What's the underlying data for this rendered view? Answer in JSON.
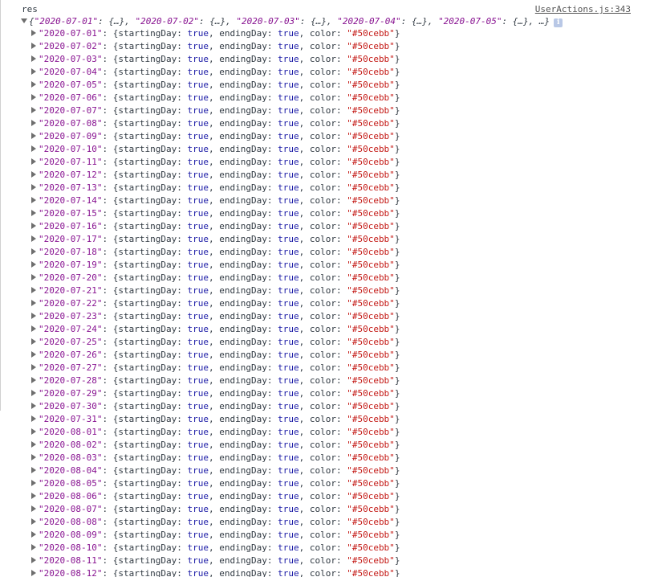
{
  "console": {
    "log_label": "res",
    "source_link": "UserActions.js:343",
    "summary": {
      "prefix": "{",
      "preview_keys": [
        "\"2020-07-01\"",
        "\"2020-07-02\"",
        "\"2020-07-03\"",
        "\"2020-07-04\"",
        "\"2020-07-05\""
      ],
      "preview_value": "{…}",
      "suffix": "…}",
      "info_icon": "i"
    },
    "field_labels": {
      "starting": "startingDay",
      "ending": "endingDay",
      "color": "color"
    },
    "colors": {
      "key": "#881391",
      "boolean": "#1a1aa6",
      "string": "#c41a16",
      "info_icon": "#b9c8e6"
    },
    "entries": [
      {
        "key": "\"2020-07-01\"",
        "startingDay": "true",
        "endingDay": "true",
        "color": "\"#50cebb\""
      },
      {
        "key": "\"2020-07-02\"",
        "startingDay": "true",
        "endingDay": "true",
        "color": "\"#50cebb\""
      },
      {
        "key": "\"2020-07-03\"",
        "startingDay": "true",
        "endingDay": "true",
        "color": "\"#50cebb\""
      },
      {
        "key": "\"2020-07-04\"",
        "startingDay": "true",
        "endingDay": "true",
        "color": "\"#50cebb\""
      },
      {
        "key": "\"2020-07-05\"",
        "startingDay": "true",
        "endingDay": "true",
        "color": "\"#50cebb\""
      },
      {
        "key": "\"2020-07-06\"",
        "startingDay": "true",
        "endingDay": "true",
        "color": "\"#50cebb\""
      },
      {
        "key": "\"2020-07-07\"",
        "startingDay": "true",
        "endingDay": "true",
        "color": "\"#50cebb\""
      },
      {
        "key": "\"2020-07-08\"",
        "startingDay": "true",
        "endingDay": "true",
        "color": "\"#50cebb\""
      },
      {
        "key": "\"2020-07-09\"",
        "startingDay": "true",
        "endingDay": "true",
        "color": "\"#50cebb\""
      },
      {
        "key": "\"2020-07-10\"",
        "startingDay": "true",
        "endingDay": "true",
        "color": "\"#50cebb\""
      },
      {
        "key": "\"2020-07-11\"",
        "startingDay": "true",
        "endingDay": "true",
        "color": "\"#50cebb\""
      },
      {
        "key": "\"2020-07-12\"",
        "startingDay": "true",
        "endingDay": "true",
        "color": "\"#50cebb\""
      },
      {
        "key": "\"2020-07-13\"",
        "startingDay": "true",
        "endingDay": "true",
        "color": "\"#50cebb\""
      },
      {
        "key": "\"2020-07-14\"",
        "startingDay": "true",
        "endingDay": "true",
        "color": "\"#50cebb\""
      },
      {
        "key": "\"2020-07-15\"",
        "startingDay": "true",
        "endingDay": "true",
        "color": "\"#50cebb\""
      },
      {
        "key": "\"2020-07-16\"",
        "startingDay": "true",
        "endingDay": "true",
        "color": "\"#50cebb\""
      },
      {
        "key": "\"2020-07-17\"",
        "startingDay": "true",
        "endingDay": "true",
        "color": "\"#50cebb\""
      },
      {
        "key": "\"2020-07-18\"",
        "startingDay": "true",
        "endingDay": "true",
        "color": "\"#50cebb\""
      },
      {
        "key": "\"2020-07-19\"",
        "startingDay": "true",
        "endingDay": "true",
        "color": "\"#50cebb\""
      },
      {
        "key": "\"2020-07-20\"",
        "startingDay": "true",
        "endingDay": "true",
        "color": "\"#50cebb\""
      },
      {
        "key": "\"2020-07-21\"",
        "startingDay": "true",
        "endingDay": "true",
        "color": "\"#50cebb\""
      },
      {
        "key": "\"2020-07-22\"",
        "startingDay": "true",
        "endingDay": "true",
        "color": "\"#50cebb\""
      },
      {
        "key": "\"2020-07-23\"",
        "startingDay": "true",
        "endingDay": "true",
        "color": "\"#50cebb\""
      },
      {
        "key": "\"2020-07-24\"",
        "startingDay": "true",
        "endingDay": "true",
        "color": "\"#50cebb\""
      },
      {
        "key": "\"2020-07-25\"",
        "startingDay": "true",
        "endingDay": "true",
        "color": "\"#50cebb\""
      },
      {
        "key": "\"2020-07-26\"",
        "startingDay": "true",
        "endingDay": "true",
        "color": "\"#50cebb\""
      },
      {
        "key": "\"2020-07-27\"",
        "startingDay": "true",
        "endingDay": "true",
        "color": "\"#50cebb\""
      },
      {
        "key": "\"2020-07-28\"",
        "startingDay": "true",
        "endingDay": "true",
        "color": "\"#50cebb\""
      },
      {
        "key": "\"2020-07-29\"",
        "startingDay": "true",
        "endingDay": "true",
        "color": "\"#50cebb\""
      },
      {
        "key": "\"2020-07-30\"",
        "startingDay": "true",
        "endingDay": "true",
        "color": "\"#50cebb\""
      },
      {
        "key": "\"2020-07-31\"",
        "startingDay": "true",
        "endingDay": "true",
        "color": "\"#50cebb\""
      },
      {
        "key": "\"2020-08-01\"",
        "startingDay": "true",
        "endingDay": "true",
        "color": "\"#50cebb\""
      },
      {
        "key": "\"2020-08-02\"",
        "startingDay": "true",
        "endingDay": "true",
        "color": "\"#50cebb\""
      },
      {
        "key": "\"2020-08-03\"",
        "startingDay": "true",
        "endingDay": "true",
        "color": "\"#50cebb\""
      },
      {
        "key": "\"2020-08-04\"",
        "startingDay": "true",
        "endingDay": "true",
        "color": "\"#50cebb\""
      },
      {
        "key": "\"2020-08-05\"",
        "startingDay": "true",
        "endingDay": "true",
        "color": "\"#50cebb\""
      },
      {
        "key": "\"2020-08-06\"",
        "startingDay": "true",
        "endingDay": "true",
        "color": "\"#50cebb\""
      },
      {
        "key": "\"2020-08-07\"",
        "startingDay": "true",
        "endingDay": "true",
        "color": "\"#50cebb\""
      },
      {
        "key": "\"2020-08-08\"",
        "startingDay": "true",
        "endingDay": "true",
        "color": "\"#50cebb\""
      },
      {
        "key": "\"2020-08-09\"",
        "startingDay": "true",
        "endingDay": "true",
        "color": "\"#50cebb\""
      },
      {
        "key": "\"2020-08-10\"",
        "startingDay": "true",
        "endingDay": "true",
        "color": "\"#50cebb\""
      },
      {
        "key": "\"2020-08-11\"",
        "startingDay": "true",
        "endingDay": "true",
        "color": "\"#50cebb\""
      },
      {
        "key": "\"2020-08-12\"",
        "startingDay": "true",
        "endingDay": "true",
        "color": "\"#50cebb\""
      }
    ]
  }
}
